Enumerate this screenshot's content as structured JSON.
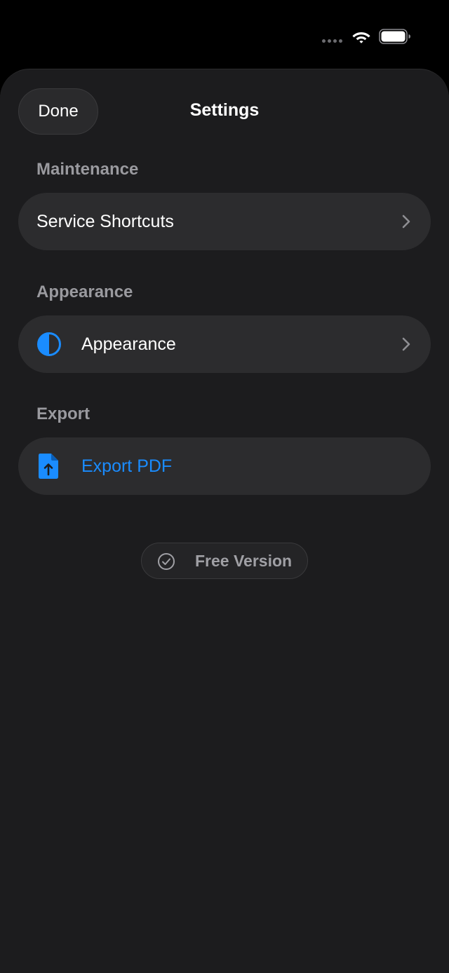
{
  "header": {
    "done_label": "Done",
    "title": "Settings"
  },
  "sections": [
    {
      "title": "Maintenance",
      "rows": [
        {
          "label": "Service Shortcuts",
          "icon": "none",
          "chevron": true
        }
      ]
    },
    {
      "title": "Appearance",
      "rows": [
        {
          "label": "Appearance",
          "icon": "half-circle-icon",
          "chevron": true
        }
      ]
    },
    {
      "title": "Export",
      "rows": [
        {
          "label": "Export PDF",
          "icon": "document-upload-icon",
          "chevron": false
        }
      ]
    }
  ],
  "badge": {
    "label": "Free Version",
    "icon": "checkmark-circle-icon"
  },
  "colors": {
    "accent": "#1a8cff",
    "sheet_background": "#1c1c1e",
    "row_background": "#2c2c2e",
    "section_header": "#9a9a9f"
  }
}
